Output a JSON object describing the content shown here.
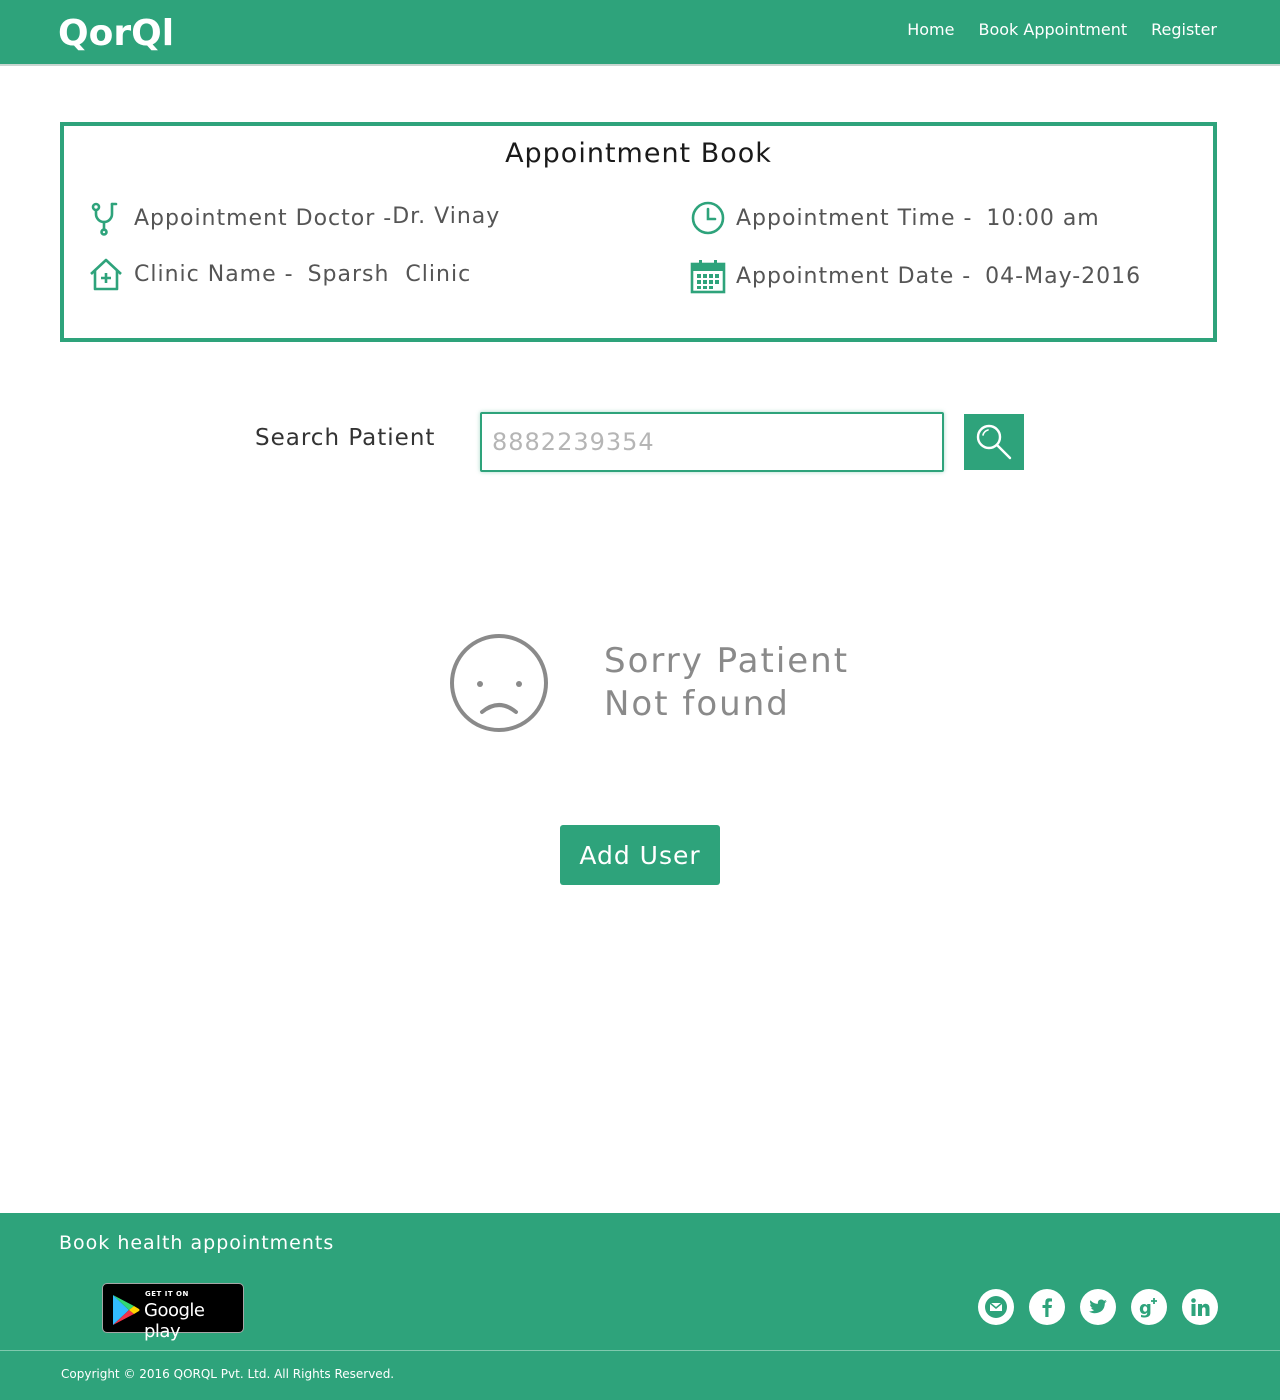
{
  "header": {
    "logo_text": "QorQl",
    "nav": [
      {
        "label": "Home"
      },
      {
        "label": "Book Appointment"
      },
      {
        "label": "Register"
      }
    ]
  },
  "appointment": {
    "title": "Appointment Book",
    "doctor_label": "Appointment Doctor -",
    "doctor_value": "Dr. Vinay",
    "time_label": "Appointment Time -",
    "time_value": "10:00 am",
    "clinic_label": "Clinic Name -",
    "clinic_value": "Sparsh  Clinic",
    "date_label": "Appointment Date -",
    "date_value": "04-May-2016"
  },
  "search": {
    "label": "Search Patient",
    "placeholder": "8882239354"
  },
  "not_found": {
    "line1": "Sorry Patient",
    "line2": "Not found"
  },
  "add_user_label": "Add User",
  "footer": {
    "tagline": "Book health appointments",
    "gplay_small": "GET IT ON",
    "gplay_big": "Google play",
    "copyright": "Copyright © 2016 QORQL Pvt. Ltd. All Rights Reserved."
  },
  "colors": {
    "brand": "#2ea37b",
    "muted_text": "#8a8a8a"
  }
}
